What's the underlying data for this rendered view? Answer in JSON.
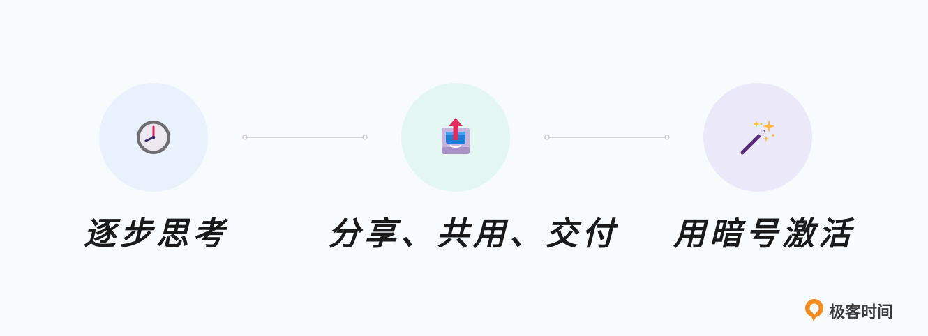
{
  "steps": [
    {
      "label": "逐步思考",
      "icon": "clock-icon"
    },
    {
      "label": "分享、共用、交付",
      "icon": "upload-tray-icon"
    },
    {
      "label": "用暗号激活",
      "icon": "magic-wand-icon"
    }
  ],
  "brand": {
    "name": "极客时间",
    "icon": "geektime-logo-icon",
    "color": "#f28b20"
  },
  "colors": {
    "background": "#f7fbfe",
    "step1_circle": "#e9f1fc",
    "step2_circle": "#e3f6f1",
    "step3_circle": "#ebe8f9",
    "connector": "#c8cacd"
  }
}
